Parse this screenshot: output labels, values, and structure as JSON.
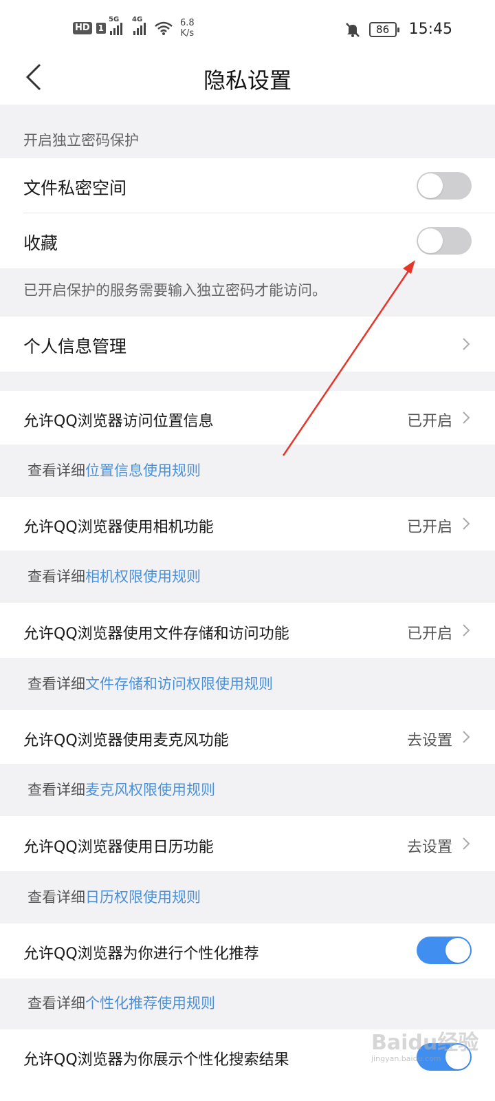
{
  "status_bar": {
    "hd": "HD",
    "sim": "1",
    "net1": "5G",
    "net2": "4G",
    "speed_value": "6.8",
    "speed_unit": "K/s",
    "battery": "86",
    "time": "15:45",
    "icons": [
      "signal-icon",
      "wifi-icon",
      "bell-muted-icon",
      "battery-icon"
    ]
  },
  "header": {
    "title": "隐私设置",
    "back_icon": "back-arrow-icon"
  },
  "password_section": {
    "label": "开启独立密码保护",
    "items": [
      {
        "label": "文件私密空间",
        "toggle": "off"
      },
      {
        "label": "收藏",
        "toggle": "off"
      }
    ],
    "note": "已开启保护的服务需要输入独立密码才能访问。"
  },
  "personal_info": {
    "label": "个人信息管理"
  },
  "permissions": [
    {
      "label": "允许QQ浏览器访问位置信息",
      "status": "已开启",
      "detail_prefix": "查看详细",
      "detail_link": "位置信息使用规则"
    },
    {
      "label": "允许QQ浏览器使用相机功能",
      "status": "已开启",
      "detail_prefix": "查看详细",
      "detail_link": "相机权限使用规则"
    },
    {
      "label": "允许QQ浏览器使用文件存储和访问功能",
      "status": "已开启",
      "detail_prefix": "查看详细",
      "detail_link": "文件存储和访问权限使用规则"
    },
    {
      "label": "允许QQ浏览器使用麦克风功能",
      "status": "去设置",
      "detail_prefix": "查看详细",
      "detail_link": "麦克风权限使用规则"
    },
    {
      "label": "允许QQ浏览器使用日历功能",
      "status": "去设置",
      "detail_prefix": "查看详细",
      "detail_link": "日历权限使用规则"
    }
  ],
  "personalization": {
    "label": "允许QQ浏览器为你进行个性化推荐",
    "toggle": "on",
    "detail_prefix": "查看详细",
    "detail_link": "个性化推荐使用规则"
  },
  "personalized_search": {
    "label": "允许QQ浏览器为你展示个性化搜索结果",
    "toggle": "on"
  },
  "colors": {
    "accent": "#3f8ef0",
    "link": "#4a90d9",
    "annotation_arrow": "#e8352a",
    "section_bg": "#f2f2f4"
  },
  "watermark": {
    "text": "Baidu经验",
    "sub": "jingyan.baidu.com"
  }
}
